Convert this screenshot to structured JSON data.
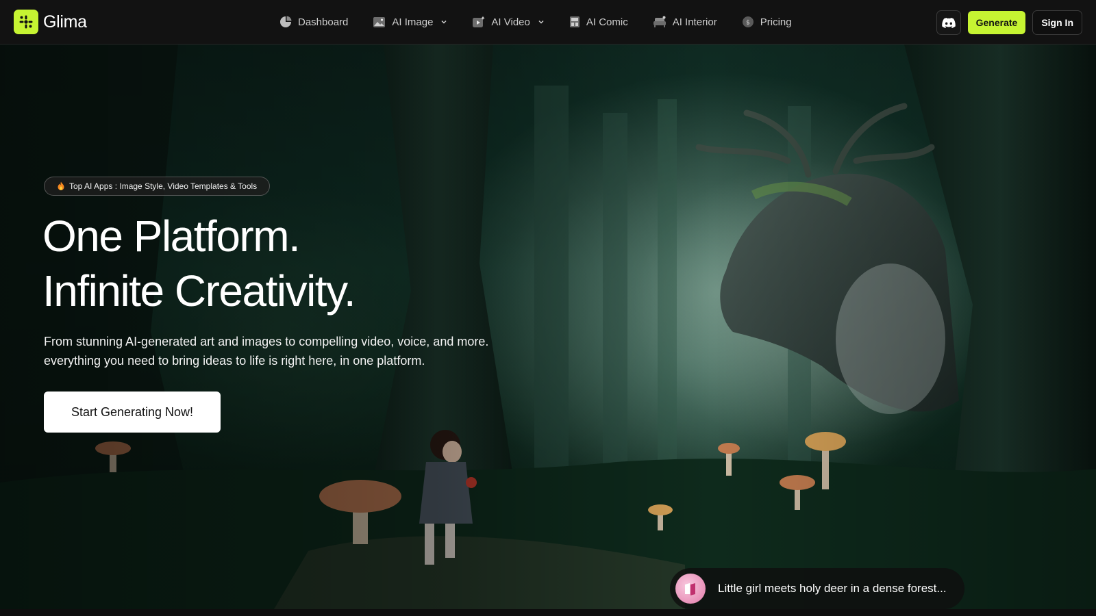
{
  "brand": {
    "name": "Glima",
    "accent": "#c6f432"
  },
  "nav": {
    "items": [
      {
        "label": "Dashboard",
        "icon": "pie-chart-icon",
        "dropdown": false
      },
      {
        "label": "AI Image",
        "icon": "image-icon",
        "dropdown": true
      },
      {
        "label": "AI Video",
        "icon": "video-icon",
        "dropdown": true
      },
      {
        "label": "AI Comic",
        "icon": "comic-icon",
        "dropdown": false
      },
      {
        "label": "AI Interior",
        "icon": "sofa-icon",
        "dropdown": false
      },
      {
        "label": "Pricing",
        "icon": "coin-icon",
        "dropdown": false
      }
    ],
    "discord_icon": "discord-icon",
    "generate_label": "Generate",
    "signin_label": "Sign In"
  },
  "hero": {
    "badge": "Top AI Apps : Image Style, Video Templates & Tools",
    "headline_line1": "One Platform.",
    "headline_line2": "Infinite Creativity.",
    "subtext": "From stunning AI-generated art and images to compelling video, voice, and more. everything you need to bring ideas to life is right here, in one platform.",
    "cta_label": "Start Generating Now!",
    "prompt_text": "Little girl meets holy deer in a dense forest..."
  }
}
